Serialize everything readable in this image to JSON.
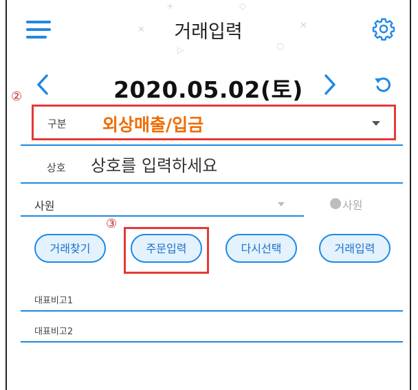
{
  "header": {
    "title": "거래입력",
    "menu_icon": "hamburger-menu-icon",
    "settings_icon": "gear-icon"
  },
  "date_nav": {
    "date": "2020.05.02(토)",
    "prev_icon": "chevron-left-icon",
    "next_icon": "chevron-right-icon",
    "reset_icon": "undo-icon"
  },
  "annotations": {
    "marker_2": "②",
    "marker_3": "③"
  },
  "form": {
    "gubun_label": "구분",
    "gubun_value": "외상매출/입금",
    "sangho_label": "상호",
    "sangho_placeholder": "상호를 입력하세요",
    "sawon_label": "사원",
    "sawon_radio_label": "사원"
  },
  "buttons": {
    "find_transaction": "거래찾기",
    "order_input": "주문입력",
    "reselect": "다시선택",
    "transaction_input": "거래입력"
  },
  "remarks": {
    "remark1_label": "대표비고1",
    "remark2_label": "대표비고2"
  },
  "colors": {
    "accent": "#1e88e5",
    "highlight": "#e53935",
    "gubun_value": "#ef6c00",
    "button_fill": "#e3f2fd"
  }
}
